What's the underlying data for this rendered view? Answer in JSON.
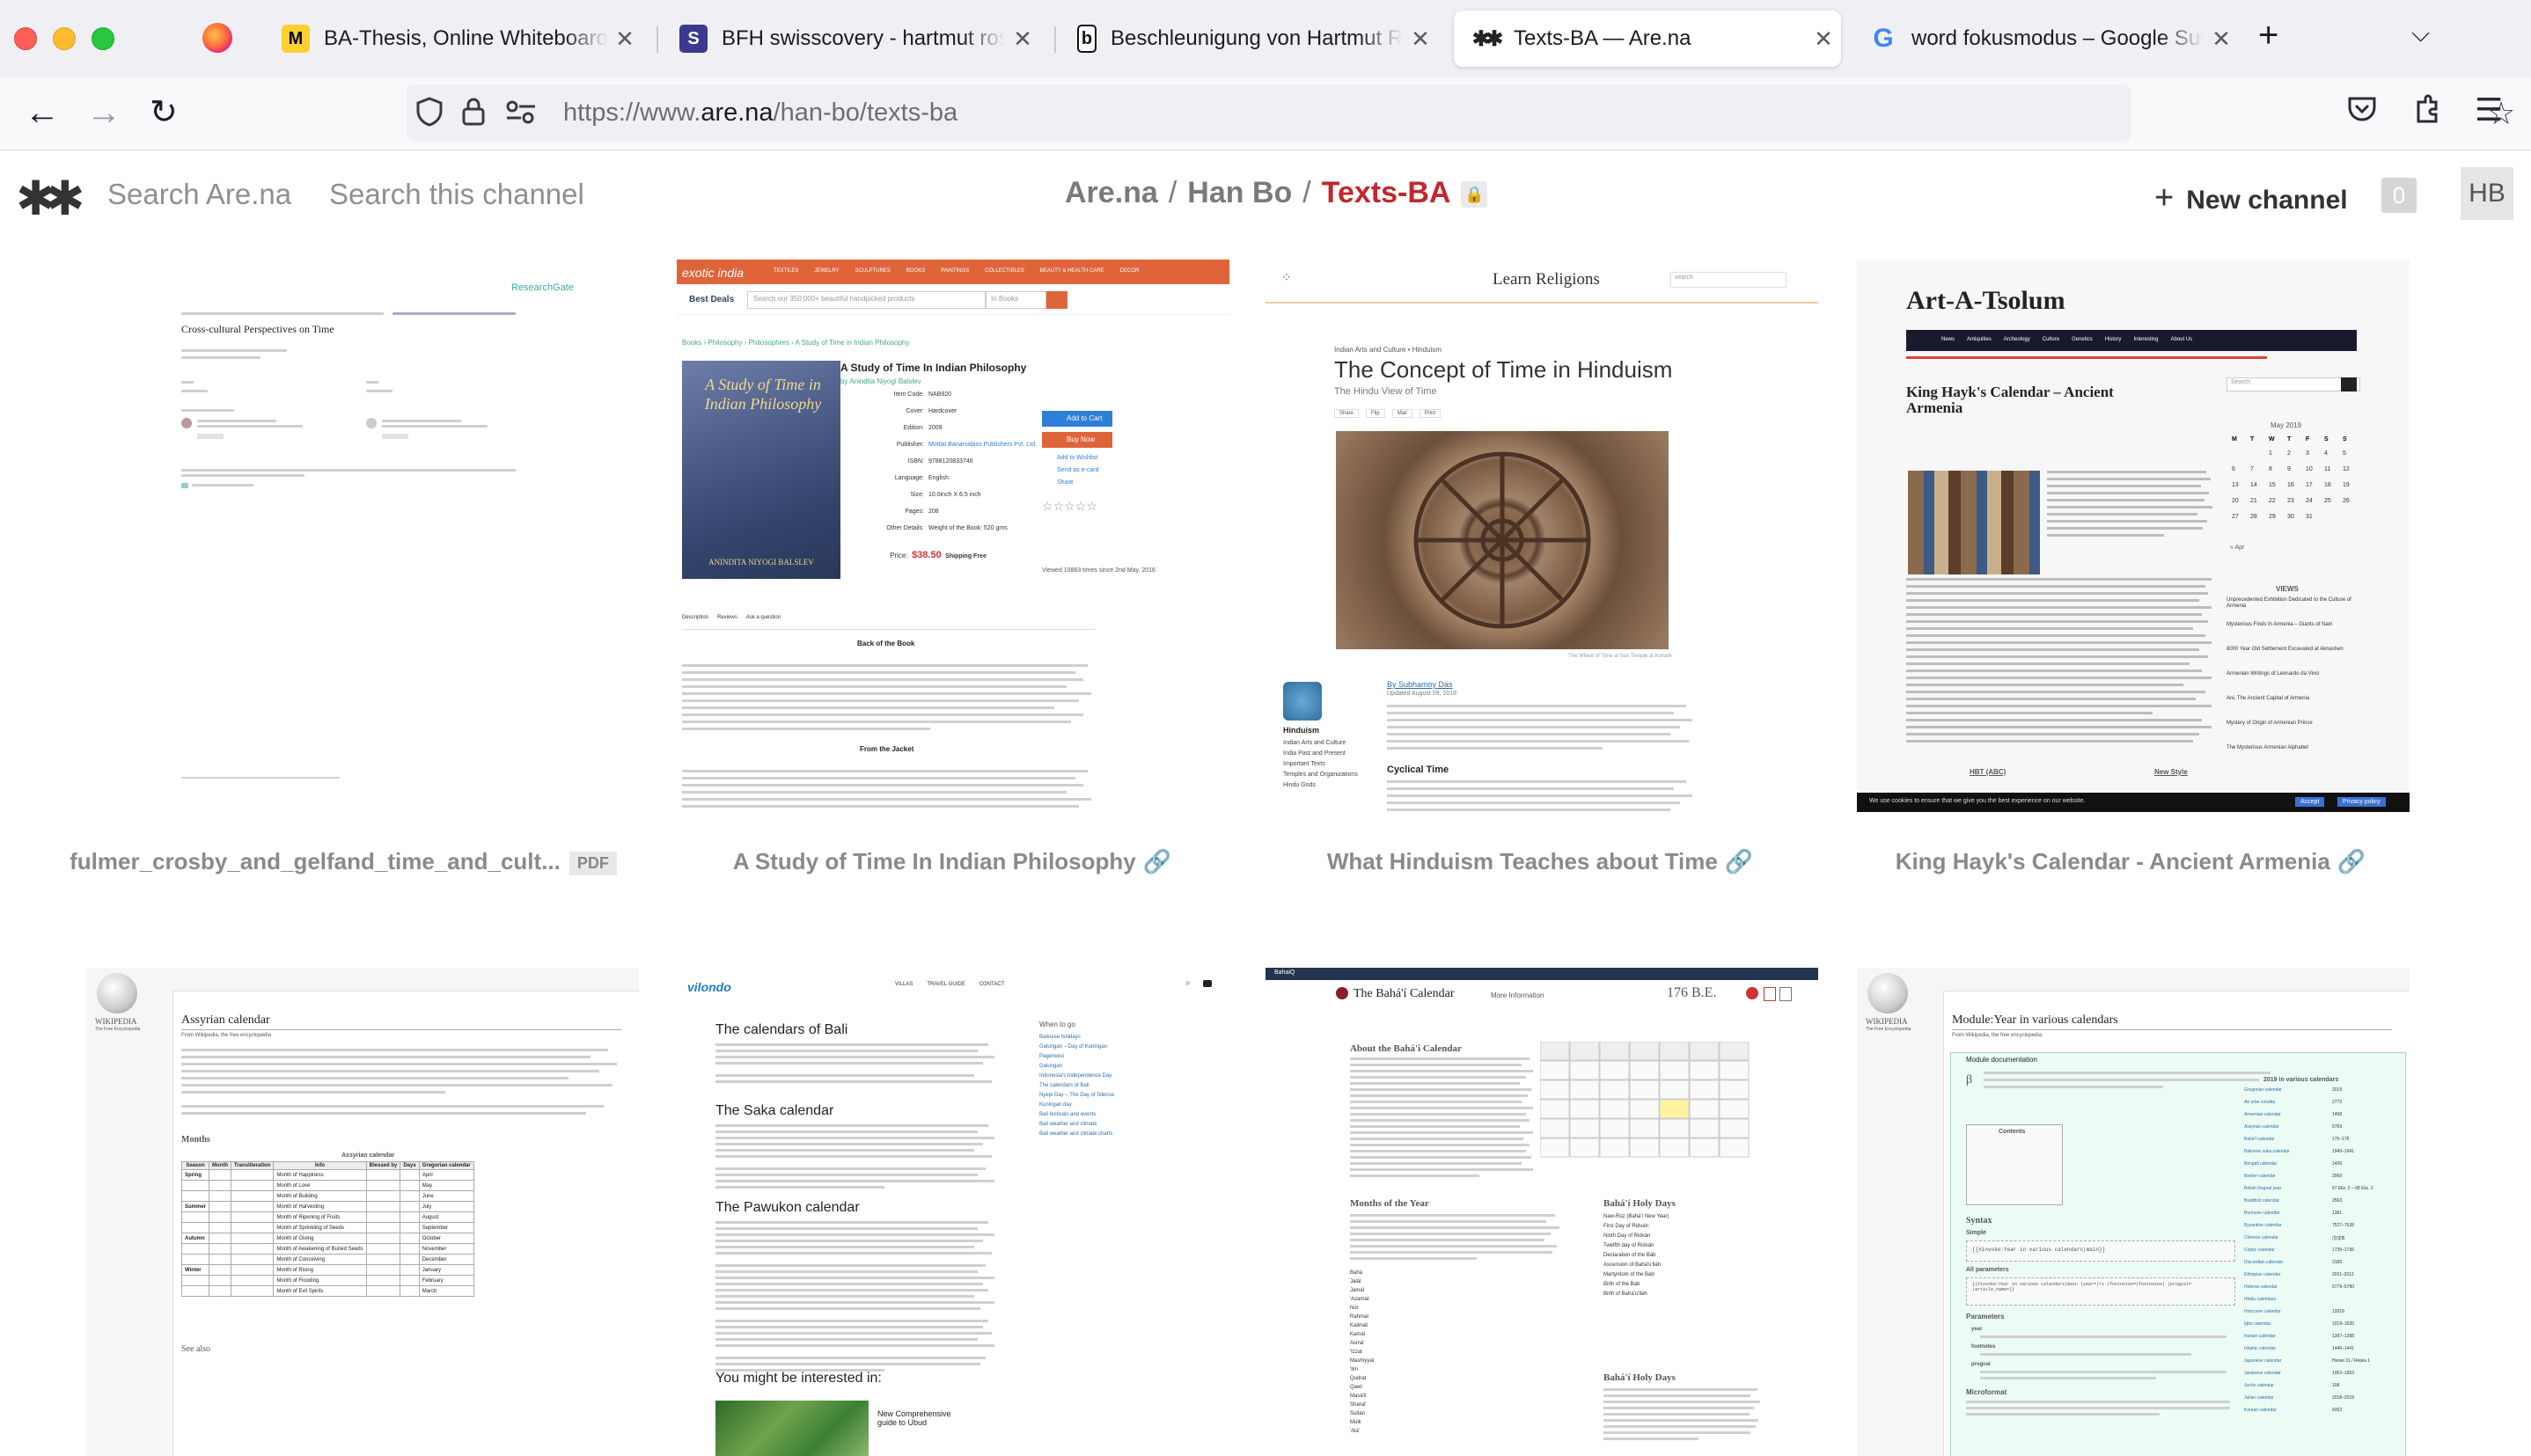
{
  "browser": {
    "tabs": [
      {
        "title": "BA-Thesis, Online Whiteboard for Visual Collaboration",
        "favicon": "miro-icon",
        "glyph": "M",
        "active": false
      },
      {
        "title": "BFH swisscovery - hartmut rosa",
        "favicon": "library-icon",
        "glyph": "S",
        "active": false
      },
      {
        "title": "Beschleunigung von Hartmut Rosa",
        "favicon": "book-icon",
        "glyph": "b",
        "active": false
      },
      {
        "title": "Texts-BA — Are.na",
        "favicon": "arena-icon",
        "glyph": "✱✱",
        "active": true
      },
      {
        "title": "word fokusmodus – Google Suche",
        "favicon": "google-icon",
        "glyph": "G",
        "active": false
      }
    ],
    "url_prefix": "https://www.",
    "url_domain": "are.na",
    "url_path": "/han-bo/texts-ba"
  },
  "arena": {
    "logo": "✱✱",
    "search_site": "Search Are.na",
    "search_channel": "Search this channel",
    "breadcrumb": {
      "site": "Are.na",
      "user": "Han Bo",
      "channel": "Texts-BA"
    },
    "new_channel": "New channel",
    "count": "0",
    "avatar": "HB"
  },
  "blocks": [
    {
      "title": "fulmer_crosby_and_gelfand_time_and_cult...",
      "badge": "PDF",
      "type": "pdf",
      "thumb": {
        "header_link": "ResearchGate",
        "heading": "Cross-cultural Perspectives on Time"
      }
    },
    {
      "title": "A Study of Time In Indian Philosophy",
      "type": "link",
      "thumb": {
        "site": "exotic india",
        "nav": [
          "TEXTILES",
          "JEWELRY",
          "SCULPTURES",
          "BOOKS",
          "PAINTINGS",
          "COLLECTIBLES",
          "BEAUTY & HEALTH CARE",
          "DECOR"
        ],
        "deals": "Best Deals",
        "search_placeholder": "Search our 350,000+ beautiful handpicked products",
        "search_scope": "In Books",
        "breadcrumb": "Books › Philosophy › Philosophers › A Study of Time in Indian Philosophy",
        "book_title": "A Study of Time In Indian Philosophy",
        "book_author": "by Anindita Niyogi Balslev",
        "cover_text": "A Study of Time in Indian Philosophy",
        "cover_author": "ANINDITA NIYOGI BALSLEV",
        "details": [
          {
            "k": "Item Code:",
            "v": "NAB920"
          },
          {
            "k": "Cover:",
            "v": "Hardcover"
          },
          {
            "k": "Edition:",
            "v": "2009"
          },
          {
            "k": "Publisher:",
            "v": "Motilal Banarsidass Publishers Pvt. Ltd."
          },
          {
            "k": "ISBN:",
            "v": "9788120833746"
          },
          {
            "k": "Language:",
            "v": "English"
          },
          {
            "k": "Size:",
            "v": "10.0inch X 6.5 inch"
          },
          {
            "k": "Pages:",
            "v": "208"
          },
          {
            "k": "Other Details:",
            "v": "Weight of the Book: 520 gms"
          }
        ],
        "price_label": "Price:",
        "price": "$38.50",
        "shipping": "Shipping Free",
        "add_to_cart": "Add to Cart",
        "buy_now": "Buy Now",
        "wishlist": "Add to Wishlist",
        "send_card": "Send as e-card",
        "share": "Share",
        "viewed": "Viewed 10863 times since 2nd May, 2016",
        "tabs": [
          "Description",
          "Reviews",
          "Ask a question"
        ],
        "back_heading": "Back of the Book",
        "jacket_heading": "From the Jacket"
      }
    },
    {
      "title": "What Hinduism Teaches about Time",
      "type": "link",
      "thumb": {
        "site": "Learn Religions",
        "search": "search",
        "crumb": "Indian Arts and Culture • Hinduism",
        "heading": "The Concept of Time in Hinduism",
        "sub": "The Hindu View of Time",
        "share": [
          "Share",
          "Flip",
          "Mail",
          "Print"
        ],
        "caption": "The Wheel of Time at Sun Temple at Konark",
        "byline": "By Subhamoy Das",
        "updated": "Updated August 09, 2018",
        "side_head": "Hinduism",
        "side_links": [
          "Indian Arts and Culture",
          "India Past and Present",
          "Important Texts",
          "Temples and Organizations",
          "Hindu Gods"
        ],
        "cyclical": "Cyclical Time"
      }
    },
    {
      "title": "King Hayk's Calendar - Ancient Armenia",
      "type": "link",
      "thumb": {
        "site": "Art-A-Tsolum",
        "nav": [
          "News",
          "Antiquities",
          "Archeology",
          "Culture",
          "Genetics",
          "History",
          "Interesting",
          "About Us"
        ],
        "heading": "King Hayk's Calendar – Ancient Armenia",
        "search": "Search",
        "cal_month": "May 2019",
        "cal_days": [
          "M",
          "T",
          "W",
          "T",
          "F",
          "S",
          "S"
        ],
        "prev": "« Apr",
        "views": "VIEWS",
        "views_list": [
          "Unprecedented Exhibition Dedicated to the Culture of Armenia",
          "Mysterious Finds In Armenia – Giants of Nairi",
          "8000 Year Old Settlement Excavated at Aknashen",
          "Armenian Writings of Leonardo da Vinci",
          "Ani, The Ancient Capital of Armenia",
          "Mystery of Origin of Armenian Prince",
          "The Mysterious Armenian Alphabet"
        ],
        "section": "HBT (ABC)",
        "new_style": "New Style",
        "cookie": "We use cookies to ensure that we give you the best experience on our website.",
        "cookie_btn": "Accept",
        "policy_btn": "Privacy policy"
      }
    },
    {
      "title": "",
      "type": "link",
      "thumb": {
        "logo_text": "WIKIPEDIA",
        "tagline": "The Free Encyclopedia",
        "heading": "Assyrian calendar",
        "from": "From Wikipedia, the free encyclopedia",
        "table_caption": "Assyrian calendar",
        "table_head": [
          "Season",
          "Month",
          "Transliteration",
          "Info",
          "Blessed by",
          "Days",
          "Gregorian calendar"
        ],
        "seasons": [
          "Spring",
          "Summer",
          "Autumn",
          "Winter"
        ],
        "months_en": [
          "Month of Happiness",
          "Month of Love",
          "Month of Building",
          "Month of Harvesting",
          "Month of Ripening of Fruits",
          "Month of Sprinkling of Seeds",
          "Month of Giving",
          "Month of Awakening of Buried Seeds",
          "Month of Conceiving",
          "Month of Rising",
          "Month of Flooding",
          "Month of Evil Spirits"
        ],
        "gregorian": [
          "April",
          "May",
          "June",
          "July",
          "August",
          "September",
          "October",
          "November",
          "December",
          "January",
          "February",
          "March"
        ],
        "months_heading": "Months",
        "see_also": "See also"
      }
    },
    {
      "title": "",
      "type": "link",
      "thumb": {
        "logo": "vilondo",
        "nav": [
          "VILLAS",
          "TRAVEL GUIDE",
          "CONTACT"
        ],
        "heading": "The calendars of Bali",
        "saka": "The Saka calendar",
        "pawukon": "The Pawukon calendar",
        "interest": "You might be interested in:",
        "related": "New Comprehensive guide to Ubud",
        "when_to_go": "When to go",
        "side_links": [
          "Balinese holidays",
          "Galungan – Day of Kuningan",
          "Pagerwesi",
          "Galungan",
          "Indonesia's Independence Day",
          "The calendars of Bali",
          "Nyepi Day – The Day of Silence",
          "Kuningan day",
          "Bali festivals and events",
          "Bali weather and climate",
          "Bali weather and climate charts"
        ]
      }
    },
    {
      "title": "",
      "type": "link",
      "thumb": {
        "topbar": "BahaiQ",
        "heading": "The Bahá'í Calendar",
        "more": "More Information",
        "year": "176 B.E.",
        "about": "About the Bahá'í Calendar",
        "months_head": "Months of the Year",
        "holy_head": "Bahá'í Holy Days",
        "holy_head2": "Bahá'í Holy Days",
        "month_names": [
          "Bahá",
          "Jalál",
          "Jamál",
          "'Azamat",
          "Núr",
          "Rahmat",
          "Kalimát",
          "Kamál",
          "Asmá'",
          "'Izzat",
          "Mashíyyat",
          "'Ilm",
          "Qudrat",
          "Qawl",
          "Masá'il",
          "Sharaf",
          "Sultán",
          "Mulk",
          "'Alá'"
        ],
        "holy_days": [
          "Naw-Rúz (Bahá'í New Year)",
          "First Day of Ridván",
          "Ninth Day of Ridván",
          "Twelfth day of Ridván",
          "Declaration of the Báb",
          "Ascension of Bahá'u'lláh",
          "Martyrdom of the Báb",
          "Birth of the Báb",
          "Birth of Bahá'u'lláh"
        ]
      }
    },
    {
      "title": "",
      "type": "link",
      "thumb": {
        "logo_text": "WIKIPEDIA",
        "tagline": "The Free Encyclopedia",
        "tabs": [
          "Module",
          "Talk"
        ],
        "heading": "Module:Year in various calendars",
        "from": "From Wikipedia, the free encyclopedia",
        "doc": "Module documentation",
        "box_head": "2019 in various calendars",
        "contents": "Contents",
        "syntax": "Syntax",
        "simple": "Simple",
        "code1": "{{#invoke:Year in various calendars|main}}",
        "all_params": "All parameters",
        "code2": "{{#invoke:Year in various calendars|main |year=|rv |footnotes=|footnotes| |progcal= |article_name=}}",
        "parameters": "Parameters",
        "param_year": "year",
        "footnotes": "footnotes",
        "progcal": "progcal",
        "microformat": "Microformat",
        "cal_names": [
          "Gregorian calendar",
          "Ab urbe condita",
          "Armenian calendar",
          "Assyrian calendar",
          "Bahá'í calendar",
          "Balinese saka calendar",
          "Bengali calendar",
          "Berber calendar",
          "British Regnal year",
          "Buddhist calendar",
          "Burmese calendar",
          "Byzantine calendar",
          "Chinese calendar",
          "Coptic calendar",
          "Discordian calendar",
          "Ethiopian calendar",
          "Hebrew calendar",
          "Hindu calendars",
          "Holocene calendar",
          "Igbo calendar",
          "Iranian calendar",
          "Islamic calendar",
          "Japanese calendar",
          "Javanese calendar",
          "Juche calendar",
          "Julian calendar",
          "Korean calendar"
        ],
        "cal_values": [
          "2019",
          "2772",
          "1468",
          "6769",
          "175–176",
          "1940–1941",
          "1426",
          "2969",
          "67 Eliz. 2 – 68 Eliz. 2",
          "2563",
          "1381",
          "7527–7528",
          "戊戌年",
          "1735–1736",
          "3185",
          "2011–2012",
          "5779–5780",
          "",
          "12019",
          "1019–1020",
          "1397–1398",
          "1440–1441",
          "Heisei 31 / Reiwa 1",
          "1952–1953",
          "108",
          "2018–2019",
          "4352"
        ]
      }
    }
  ]
}
